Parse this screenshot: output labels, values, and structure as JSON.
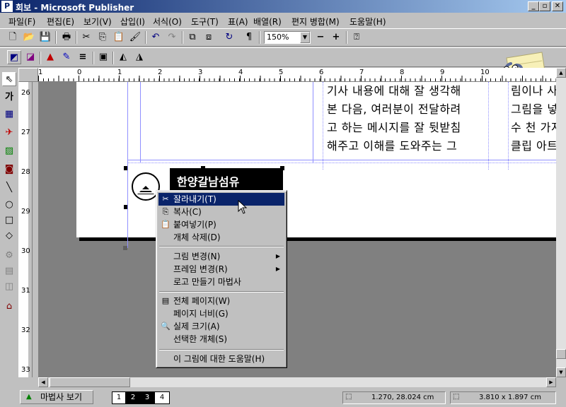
{
  "window": {
    "title": "회보 - Microsoft Publisher",
    "app_icon": "P"
  },
  "window_controls": {
    "minimize": "_",
    "maximize": "▫",
    "close": "✕"
  },
  "menu": [
    "파일(F)",
    "편집(E)",
    "보기(V)",
    "삽입(I)",
    "서식(O)",
    "도구(T)",
    "표(A)",
    "배열(R)",
    "편지 병합(M)",
    "도움말(H)"
  ],
  "toolbar": {
    "zoom": "150%",
    "zoom_out": "−",
    "zoom_in": "+",
    "paragraph": "¶"
  },
  "left_tools": {
    "text_tool": "가"
  },
  "ruler": {
    "h_marks": [
      "1",
      "0",
      "1",
      "2",
      "3",
      "4",
      "5",
      "6",
      "7",
      "8",
      "9",
      "10"
    ],
    "v_marks": [
      "26",
      "27",
      "28",
      "29",
      "30",
      "31",
      "32",
      "33"
    ]
  },
  "document": {
    "col1_lines": [
      "기사 내용에 대해 잘 생각해",
      "본 다음, 여러분이 전달하려",
      "고 하는 메시지를 잘 뒷받침",
      "해주고 이해를 도와주는 그"
    ],
    "col2_lines": [
      "림이나 사진을 선택합니다.",
      "그림을 넣을 수 있는 방법은",
      "수 천 가지가 있으며, 여러",
      "클립 아트 갤러리에서 그림"
    ],
    "logo_text": "한양갈남섬유"
  },
  "context_menu": {
    "items": [
      {
        "label": "잘라내기(T)",
        "icon": "scissors-icon"
      },
      {
        "label": "복사(C)",
        "icon": "copy-icon"
      },
      {
        "label": "붙여넣기(P)",
        "icon": "paste-icon"
      },
      {
        "label": "개체 삭제(D)",
        "icon": ""
      },
      {
        "label": "그림 변경(N)",
        "icon": "",
        "submenu": true
      },
      {
        "label": "프레임 변경(R)",
        "icon": "",
        "submenu": true
      },
      {
        "label": "로고 만들기 마법사",
        "icon": ""
      },
      {
        "label": "전체 페이지(W)",
        "icon": "page-icon"
      },
      {
        "label": "페이지 너비(G)",
        "icon": ""
      },
      {
        "label": "실제 크기(A)",
        "icon": "magnifier-icon"
      },
      {
        "label": "선택한 개체(S)",
        "icon": ""
      },
      {
        "label": "이 그림에 대한 도움말(H)",
        "icon": ""
      }
    ],
    "selected": "잘라내기(T)"
  },
  "status": {
    "wizard_button": "마법사 보기",
    "pages": [
      "1",
      "2",
      "3",
      "4"
    ],
    "active_page": "4",
    "position": "1.270, 28.024 cm",
    "size": "3.810 x 1.897 cm"
  },
  "colors": {
    "titlebar": "#0a246a",
    "face": "#c0c0c0",
    "workspace": "#808080",
    "guide": "#9090ff"
  }
}
